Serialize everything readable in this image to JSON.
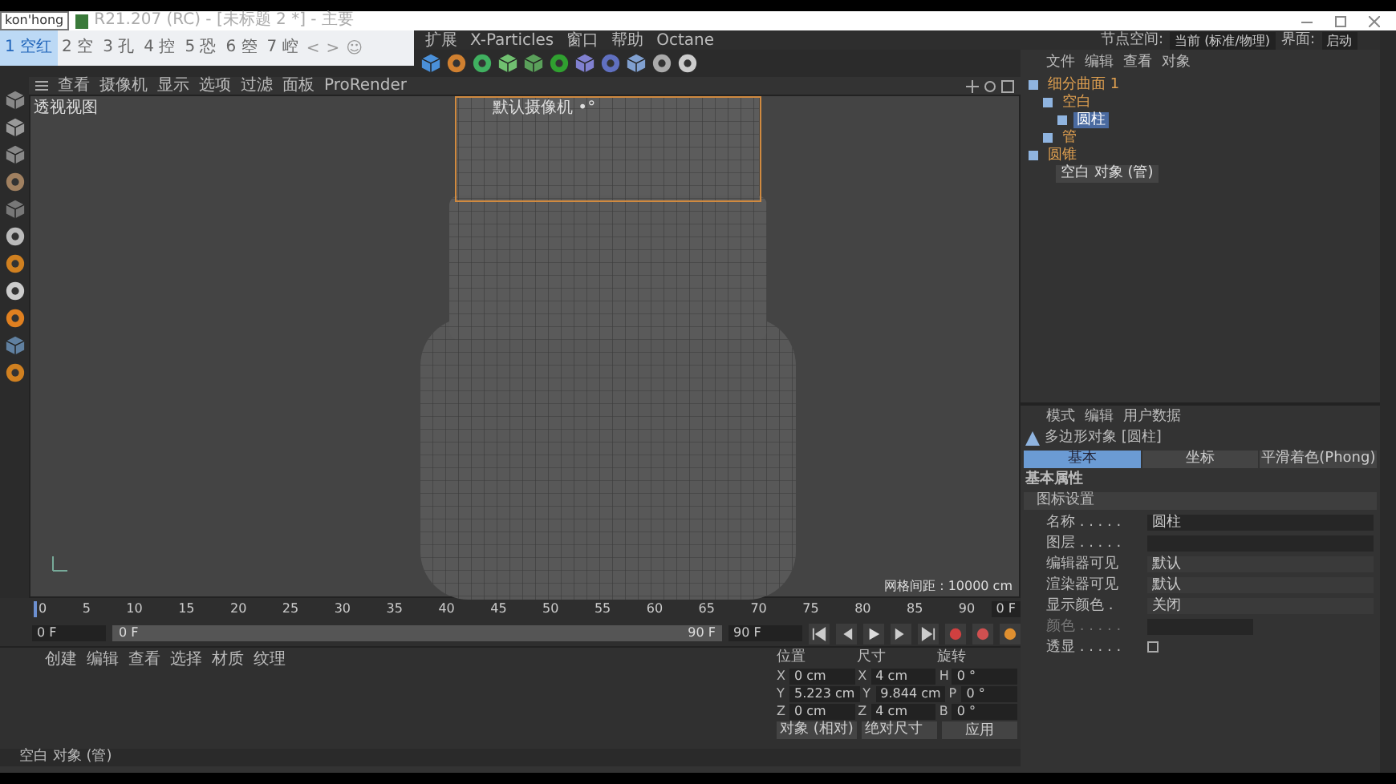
{
  "title_bar": {
    "ime_input": "kon'hong",
    "title": "R21.207 (RC) - [未标题 2 *] - 主要"
  },
  "ime": {
    "candidates": [
      {
        "label": "1 空红",
        "selected": true
      },
      {
        "label": "2 空",
        "selected": false
      },
      {
        "label": "3 孔",
        "selected": false
      },
      {
        "label": "4 控",
        "selected": false
      },
      {
        "label": "5 恐",
        "selected": false
      },
      {
        "label": "6 箜",
        "selected": false
      },
      {
        "label": "7 崆",
        "selected": false
      }
    ],
    "prev": "<",
    "next": ">",
    "emoji": "☺"
  },
  "menu_bar": [
    "扩展",
    "X-Particles",
    "窗口",
    "帮助",
    "Octane"
  ],
  "viewport": {
    "menu": [
      "查看",
      "摄像机",
      "显示",
      "选项",
      "过滤",
      "面板",
      "ProRender"
    ],
    "view_name": "透视视图",
    "camera": "默认摄像机 •°",
    "grid_spacing": "网格间距 : 10000 cm"
  },
  "object_manager": {
    "node_space_label": "节点空间:",
    "node_space": "当前 (标准/物理)",
    "interface_label": "界面:",
    "interface": "启动",
    "menu": [
      "文件",
      "编辑",
      "查看",
      "对象"
    ],
    "objects": [
      {
        "name": "细分曲面 1",
        "selected": false,
        "children": [
          {
            "name": "空白",
            "selected": false,
            "children": [
              {
                "name": "圆柱",
                "selected": true
              }
            ]
          },
          {
            "name": "管",
            "selected": false
          }
        ]
      },
      {
        "name": "圆锥",
        "selected": false
      }
    ],
    "tooltip": "空白 对象 (管)"
  },
  "attributes": {
    "menu": [
      "模式",
      "编辑",
      "用户数据"
    ],
    "object_title": "多边形对象 [圆柱]",
    "tabs": [
      {
        "label": "基本",
        "selected": true
      },
      {
        "label": "坐标",
        "selected": false
      },
      {
        "label": "平滑着色(Phong)",
        "selected": false
      }
    ],
    "section": "基本属性",
    "group": "图标设置",
    "fields": [
      {
        "kind": "text",
        "label": "名称 . . . . .",
        "value": "圆柱"
      },
      {
        "kind": "link",
        "label": "图层 . . . . ."
      },
      {
        "kind": "dropdown",
        "label": "编辑器可见",
        "value": "默认"
      },
      {
        "kind": "dropdown",
        "label": "渲染器可见",
        "value": "默认"
      },
      {
        "kind": "dropdown",
        "label": "显示颜色 .",
        "value": "关闭"
      },
      {
        "kind": "color",
        "label": "颜色 . . . . ."
      },
      {
        "kind": "checkbox",
        "label": "透显 . . . . .",
        "checked": false
      }
    ]
  },
  "timeline": {
    "ticks": [
      "0",
      "5",
      "10",
      "15",
      "20",
      "25",
      "30",
      "35",
      "40",
      "45",
      "50",
      "55",
      "60",
      "65",
      "70",
      "75",
      "80",
      "85",
      "90"
    ],
    "current_frame": "0 F",
    "start": "0 F",
    "range_start": "0 F",
    "range_end": "90 F",
    "end": "90 F",
    "level": 1
  },
  "materials": {
    "menu": [
      "创建",
      "编辑",
      "查看",
      "选择",
      "材质",
      "纹理"
    ]
  },
  "coordinates": {
    "headers": [
      "位置",
      "尺寸",
      "旋转"
    ],
    "rows": [
      {
        "position_axis": "X",
        "position": "0 cm",
        "size_axis": "X",
        "size": "4 cm",
        "rotation_axis": "H",
        "rotation": "0 °"
      },
      {
        "position_axis": "Y",
        "position": "5.223 cm",
        "size_axis": "Y",
        "size": "9.844 cm",
        "rotation_axis": "P",
        "rotation": "0 °"
      },
      {
        "position_axis": "Z",
        "position": "0 cm",
        "size_axis": "Z",
        "size": "4 cm",
        "rotation_axis": "B",
        "rotation": "0 °"
      }
    ],
    "mode": "对象 (相对)",
    "size_mode": "绝对尺寸",
    "apply": "应用"
  },
  "status_bar": "空白 对象 (管)"
}
